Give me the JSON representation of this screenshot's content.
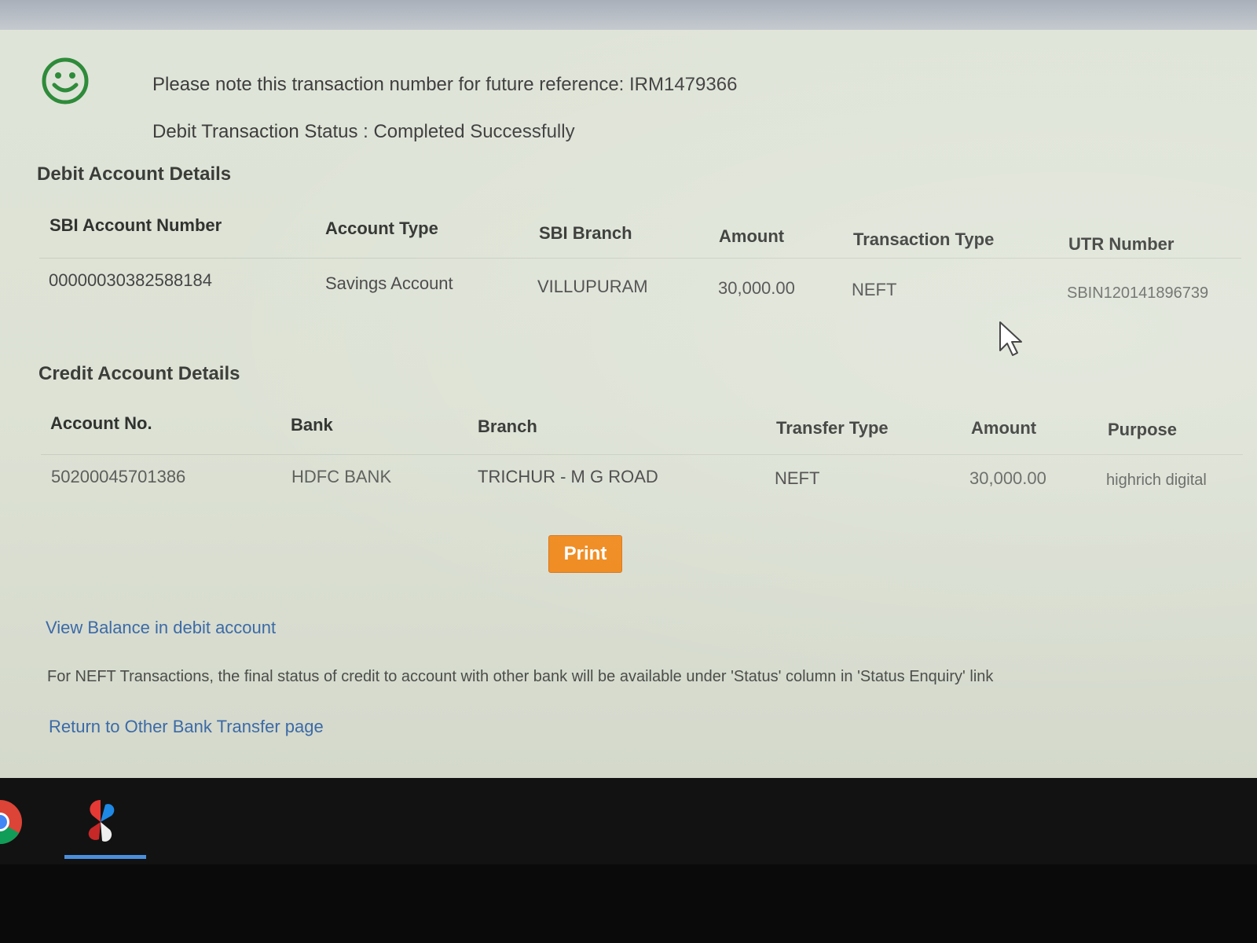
{
  "confirmation": {
    "note": "Please note this transaction number for future reference: IRM1479366",
    "status": "Debit Transaction Status : Completed Successfully"
  },
  "debit": {
    "title": "Debit Account Details",
    "headers": [
      "SBI Account Number",
      "Account Type",
      "SBI Branch",
      "Amount",
      "Transaction Type",
      "UTR Number"
    ],
    "row": [
      "00000030382588184",
      "Savings Account",
      "VILLUPURAM",
      "30,000.00",
      "NEFT",
      "SBIN120141896739"
    ]
  },
  "credit": {
    "title": "Credit Account Details",
    "headers": [
      "Account No.",
      "Bank",
      "Branch",
      "Transfer Type",
      "Amount",
      "Purpose"
    ],
    "row": [
      "50200045701386",
      "HDFC BANK",
      "TRICHUR - M G ROAD",
      "NEFT",
      "30,000.00",
      "highrich digital"
    ]
  },
  "actions": {
    "print_label": "Print",
    "view_balance_link": "View Balance in debit account",
    "neft_note": "For NEFT Transactions, the final status of credit to account with other bank will be available under 'Status' column in 'Status Enquiry' link",
    "return_link": "Return to Other Bank Transfer page"
  },
  "colors": {
    "success_green": "#2e8b3a",
    "print_button": "#f08a1e",
    "link_blue": "#3c6aa6"
  },
  "icons": {
    "status": "smiley-icon",
    "pointer": "mouse-cursor-icon",
    "taskbar": [
      "chrome-icon",
      "app-icon"
    ]
  }
}
